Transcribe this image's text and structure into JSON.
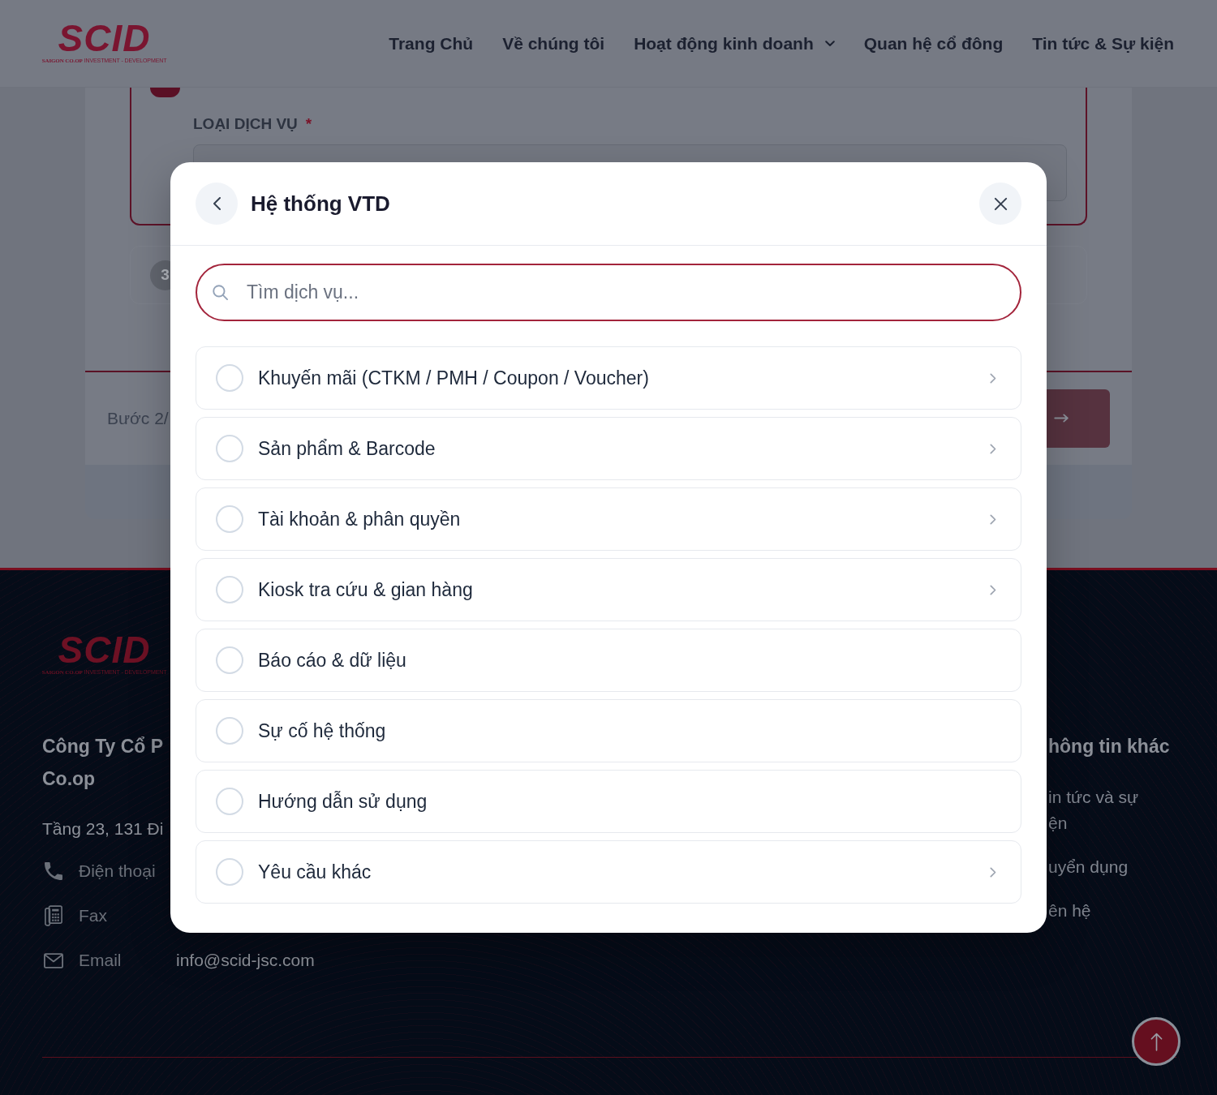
{
  "header": {
    "logo": {
      "name": "SCID",
      "tagline": "**SAIGON CO.OP** INVESTMENT - DEVELOPMENT"
    },
    "nav": [
      {
        "label": "Trang Chủ",
        "has_dropdown": false
      },
      {
        "label": "Về chúng tôi",
        "has_dropdown": false
      },
      {
        "label": "Hoạt động kinh doanh",
        "has_dropdown": true
      },
      {
        "label": "Quan hệ cổ đông",
        "has_dropdown": false
      },
      {
        "label": "Tin tức & Sự kiện",
        "has_dropdown": false
      }
    ]
  },
  "form_card": {
    "active_step": {
      "field_label": "LOẠI DỊCH VỤ",
      "required_mark": "*"
    },
    "next_step": {
      "number": "3"
    },
    "footer": {
      "progress_text": "Bước 2/"
    }
  },
  "modal": {
    "title": "Hệ thống VTD",
    "search": {
      "placeholder": "Tìm dịch vụ...",
      "focused": true
    },
    "options": [
      {
        "label": "Khuyến mãi (CTKM / PMH / Coupon / Voucher)",
        "selected": false,
        "has_submenu": true
      },
      {
        "label": "Sản phẩm & Barcode",
        "selected": false,
        "has_submenu": true
      },
      {
        "label": "Tài khoản & phân quyền",
        "selected": false,
        "has_submenu": true
      },
      {
        "label": "Kiosk tra cứu & gian hàng",
        "selected": false,
        "has_submenu": true
      },
      {
        "label": "Báo cáo & dữ liệu",
        "selected": false,
        "has_submenu": false
      },
      {
        "label": "Sự cố hệ thống",
        "selected": false,
        "has_submenu": false
      },
      {
        "label": "Hướng dẫn sử dụng",
        "selected": false,
        "has_submenu": false
      },
      {
        "label": "Yêu cầu khác",
        "selected": false,
        "has_submenu": true
      }
    ]
  },
  "footer": {
    "logo": {
      "name": "SCID",
      "tagline": "**SAIGON CO.OP** INVESTMENT - DEVELOPMENT"
    },
    "company_name_lines": [
      "Công Ty Cổ P",
      "Co.op"
    ],
    "address": "Tầng 23, 131 Đi",
    "contacts": [
      {
        "kind": "phone",
        "label": "Điện thoại"
      },
      {
        "kind": "fax",
        "label": "Fax"
      },
      {
        "kind": "email",
        "label": "Email",
        "value": "info@scid-jsc.com"
      }
    ],
    "other_info": {
      "title": "hông tin khác",
      "links": [
        {
          "lines": [
            "in tức và sự",
            "ện"
          ]
        },
        {
          "lines": [
            "uyển dụng"
          ]
        },
        {
          "lines": [
            "ên hệ"
          ]
        }
      ]
    }
  }
}
